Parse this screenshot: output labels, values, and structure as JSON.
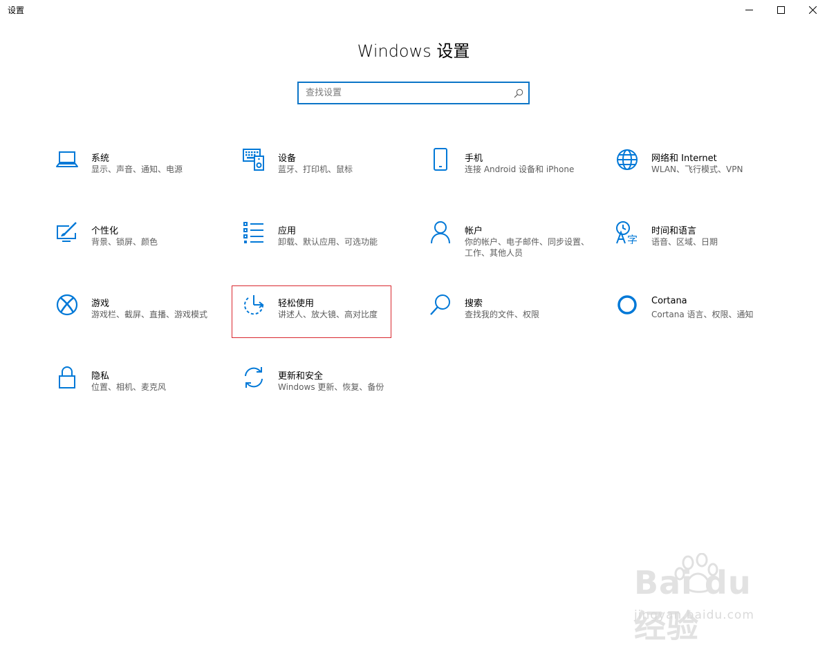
{
  "window": {
    "title": "设置"
  },
  "header": {
    "title": "Windows 设置"
  },
  "search": {
    "placeholder": "查找设置"
  },
  "accent_color": "#0078d7",
  "highlight_color": "#d9272e",
  "tiles": [
    {
      "icon": "laptop-icon",
      "title": "系统",
      "desc": "显示、声音、通知、电源"
    },
    {
      "icon": "keyboard-speaker-icon",
      "title": "设备",
      "desc": "蓝牙、打印机、鼠标"
    },
    {
      "icon": "phone-icon",
      "title": "手机",
      "desc": "连接 Android 设备和 iPhone"
    },
    {
      "icon": "globe-icon",
      "title": "网络和 Internet",
      "desc": "WLAN、飞行模式、VPN"
    },
    {
      "icon": "paint-monitor-icon",
      "title": "个性化",
      "desc": "背景、锁屏、颜色"
    },
    {
      "icon": "apps-list-icon",
      "title": "应用",
      "desc": "卸载、默认应用、可选功能"
    },
    {
      "icon": "person-icon",
      "title": "帐户",
      "desc": "你的帐户、电子邮件、同步设置、工作、其他人员"
    },
    {
      "icon": "time-language-icon",
      "title": "时间和语言",
      "desc": "语音、区域、日期"
    },
    {
      "icon": "xbox-icon",
      "title": "游戏",
      "desc": "游戏栏、截屏、直播、游戏模式"
    },
    {
      "icon": "ease-of-access-icon",
      "title": "轻松使用",
      "desc": "讲述人、放大镜、高对比度"
    },
    {
      "icon": "search-icon",
      "title": "搜索",
      "desc": "查找我的文件、权限"
    },
    {
      "icon": "cortana-icon",
      "title": "Cortana",
      "desc": "Cortana 语言、权限、通知"
    },
    {
      "icon": "lock-icon",
      "title": "隐私",
      "desc": "位置、相机、麦克风"
    },
    {
      "icon": "sync-icon",
      "title": "更新和安全",
      "desc": "Windows 更新、恢复、备份"
    }
  ],
  "watermark": {
    "brand": "Bai du 经验",
    "url": "jingyan.baidu.com"
  }
}
